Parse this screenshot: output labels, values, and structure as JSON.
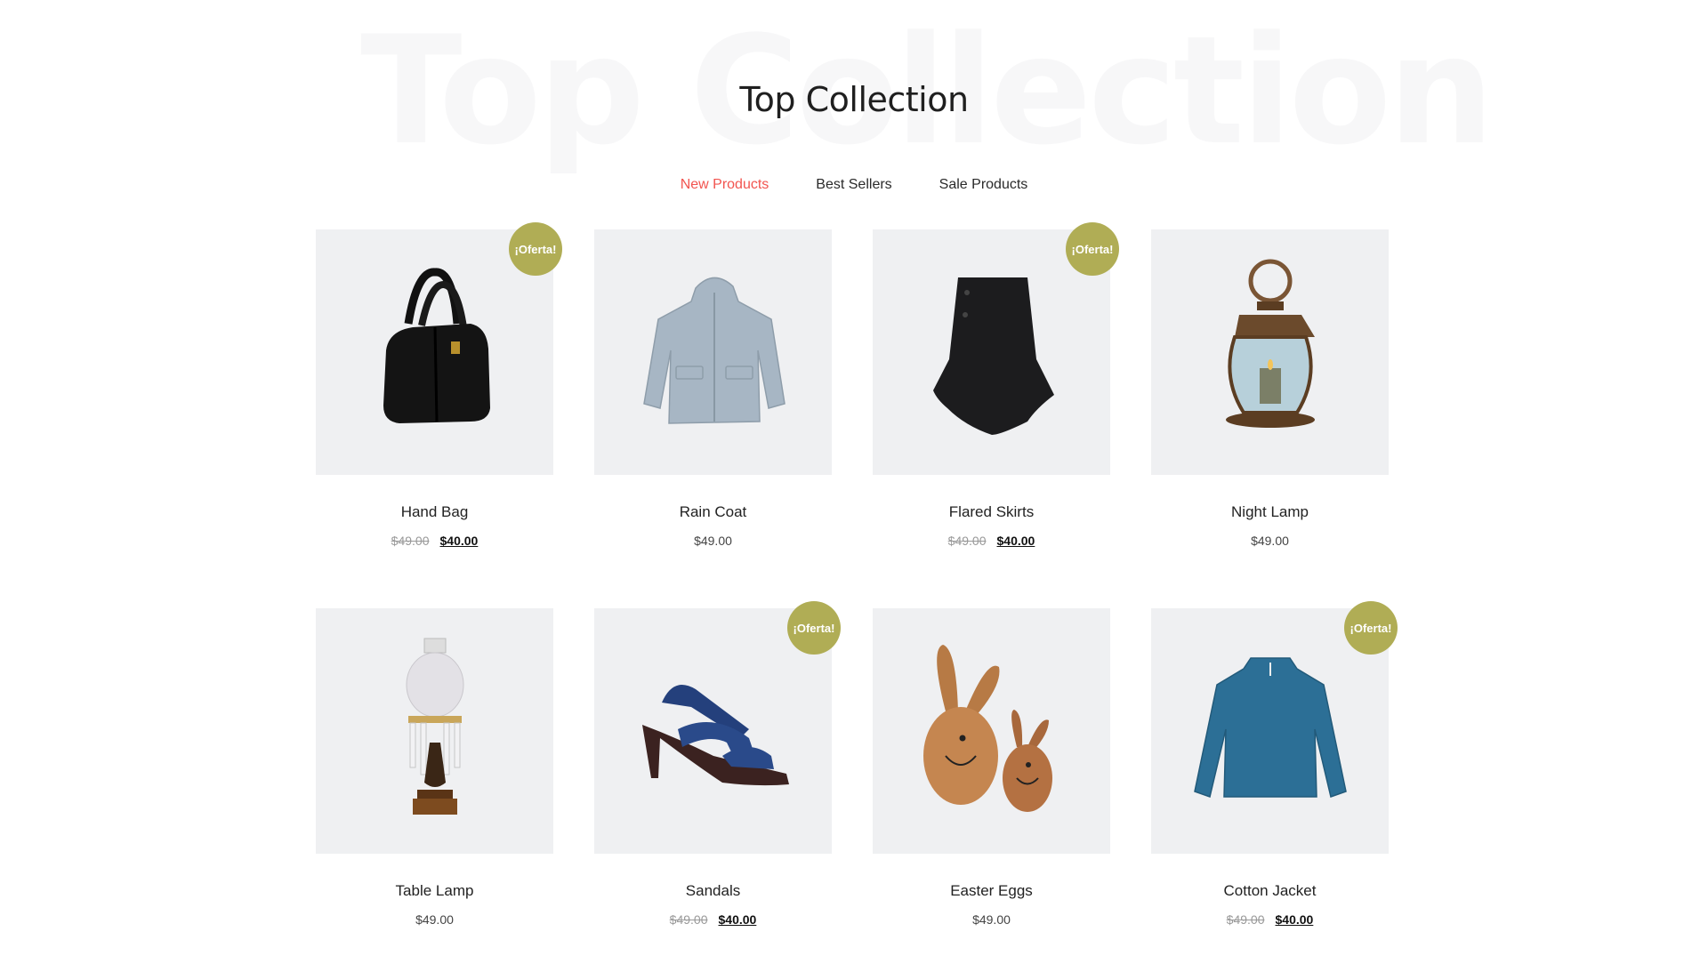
{
  "section": {
    "watermark": "Top Collection",
    "title": "Top Collection"
  },
  "tabs": [
    {
      "label": "New Products",
      "active": true
    },
    {
      "label": "Best Sellers",
      "active": false
    },
    {
      "label": "Sale Products",
      "active": false
    }
  ],
  "colors": {
    "accent": "#f2544f",
    "badge": "#b0ad55",
    "thumb_bg": "#eff0f2"
  },
  "products": [
    {
      "name": "Hand Bag",
      "on_sale": true,
      "badge": "¡Oferta!",
      "old_price": "$49.00",
      "price": "$40.00",
      "image": "handbag"
    },
    {
      "name": "Rain Coat",
      "on_sale": false,
      "badge": "",
      "old_price": "",
      "price": "$49.00",
      "image": "raincoat"
    },
    {
      "name": "Flared Skirts",
      "on_sale": true,
      "badge": "¡Oferta!",
      "old_price": "$49.00",
      "price": "$40.00",
      "image": "skirt"
    },
    {
      "name": "Night Lamp",
      "on_sale": false,
      "badge": "",
      "old_price": "",
      "price": "$49.00",
      "image": "lantern"
    },
    {
      "name": "Table Lamp",
      "on_sale": false,
      "badge": "",
      "old_price": "",
      "price": "$49.00",
      "image": "tablelamp"
    },
    {
      "name": "Sandals",
      "on_sale": true,
      "badge": "¡Oferta!",
      "old_price": "$49.00",
      "price": "$40.00",
      "image": "sandal"
    },
    {
      "name": "Easter Eggs",
      "on_sale": false,
      "badge": "",
      "old_price": "",
      "price": "$49.00",
      "image": "bunnies"
    },
    {
      "name": "Cotton Jacket",
      "on_sale": true,
      "badge": "¡Oferta!",
      "old_price": "$49.00",
      "price": "$40.00",
      "image": "jacket"
    }
  ]
}
